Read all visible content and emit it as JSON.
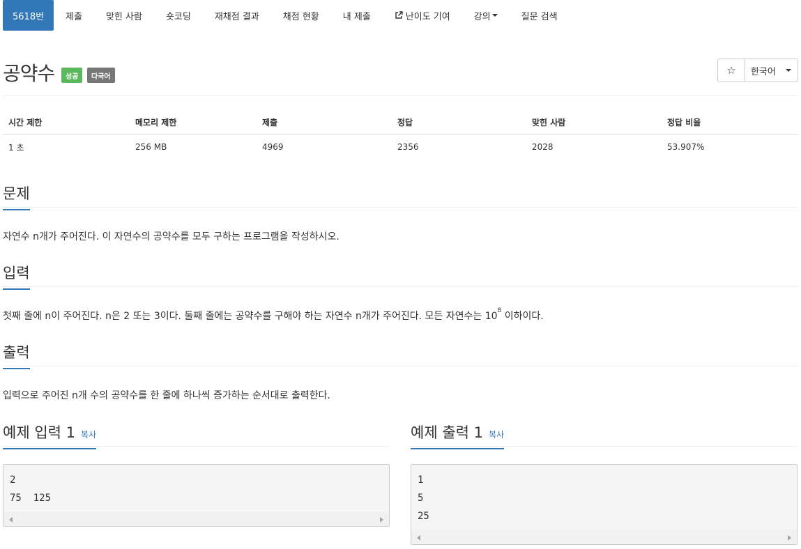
{
  "nav": {
    "items": [
      {
        "label": "5618번"
      },
      {
        "label": "제출"
      },
      {
        "label": "맞힌 사람"
      },
      {
        "label": "숏코딩"
      },
      {
        "label": "재채점 결과"
      },
      {
        "label": "채점 현황"
      },
      {
        "label": "내 제출"
      },
      {
        "label": "난이도 기여",
        "icon": "external-link-icon"
      },
      {
        "label": "강의",
        "icon": "caret-down-icon"
      },
      {
        "label": "질문 검색"
      }
    ]
  },
  "header": {
    "title": "공약수",
    "badge_success": "성공",
    "badge_multi": "다국어",
    "star": "☆",
    "language": "한국어"
  },
  "info": {
    "headers": [
      "시간 제한",
      "메모리 제한",
      "제출",
      "정답",
      "맞힌 사람",
      "정답 비율"
    ],
    "values": [
      "1 초",
      "256 MB",
      "4969",
      "2356",
      "2028",
      "53.907%"
    ]
  },
  "problem": {
    "title": "문제",
    "text": "자연수 n개가 주어진다. 이 자연수의 공약수를 모두 구하는 프로그램을 작성하시오."
  },
  "input": {
    "title": "입력",
    "text_before": "첫째 줄에 n이 주어진다. n은 2 또는 3이다. 둘째 줄에는 공약수를 구해야 하는 자연수 n개가 주어진다. 모든 자연수는 10",
    "sup": "8",
    "text_after": " 이하이다."
  },
  "output": {
    "title": "출력",
    "text": "입력으로 주어진 n개 수의 공약수를 한 줄에 하나씩 증가하는 순서대로 출력한다."
  },
  "examples": {
    "input_title": "예제 입력 1",
    "output_title": "예제 출력 1",
    "copy_label": "복사",
    "input_lines": [
      "2",
      "75  125"
    ],
    "output_lines": [
      "1",
      "5",
      "25"
    ]
  },
  "colors": {
    "accent": "#3278b8",
    "success": "#5cb85c",
    "muted": "#777777"
  }
}
